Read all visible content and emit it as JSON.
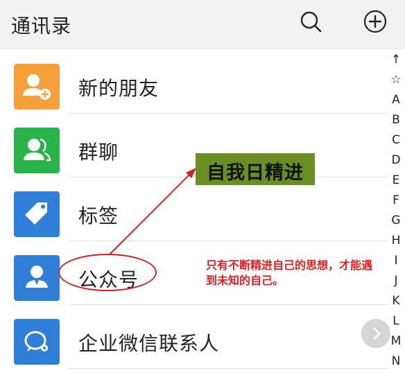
{
  "header": {
    "title": "通讯录",
    "search_icon": "search-icon",
    "add_icon": "plus-circle-icon"
  },
  "rows": [
    {
      "label": "新的朋友",
      "icon": "add-friend-icon",
      "color": "#f5a13b"
    },
    {
      "label": "群聊",
      "icon": "group-chat-icon",
      "color": "#29b44a"
    },
    {
      "label": "标签",
      "icon": "tag-icon",
      "color": "#2f7ed8"
    },
    {
      "label": "公众号",
      "icon": "official-account-icon",
      "color": "#2f7ed8"
    },
    {
      "label": "企业微信联系人",
      "icon": "wecom-icon",
      "color": "#2f7ed8"
    }
  ],
  "index_bar": [
    "↑",
    "☆",
    "A",
    "B",
    "C",
    "D",
    "E",
    "F",
    "G",
    "H",
    "I",
    "J",
    "K",
    "L",
    "M",
    "N"
  ],
  "annotation": {
    "callout": "自我日精进",
    "note": "只有不断精进自己的思想，才能遇到未知的自己。",
    "callout_color": "#6b8e23",
    "note_color": "#e02020"
  }
}
